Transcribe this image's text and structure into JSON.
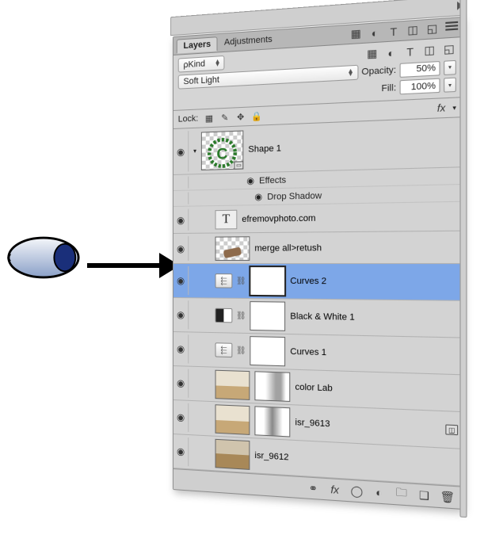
{
  "tabs": {
    "layers": "Layers",
    "adjustments": "Adjustments"
  },
  "filter": {
    "kind_label": "Kind",
    "blend_mode": "Soft Light",
    "opacity_label": "Opacity:",
    "opacity_value": "50%",
    "fill_label": "Fill:",
    "fill_value": "100%"
  },
  "lock": {
    "label": "Lock:",
    "fx": "fx"
  },
  "layers": {
    "shape1": "Shape 1",
    "effects": "Effects",
    "drop_shadow": "Drop Shadow",
    "text_layer": "efremovphoto.com",
    "merge": "merge all>retush",
    "curves2": "Curves 2",
    "bw1": "Black & White 1",
    "curves1": "Curves 1",
    "colorlab": "color Lab",
    "isr9613": "isr_9613",
    "isr9612": "isr_9612"
  }
}
